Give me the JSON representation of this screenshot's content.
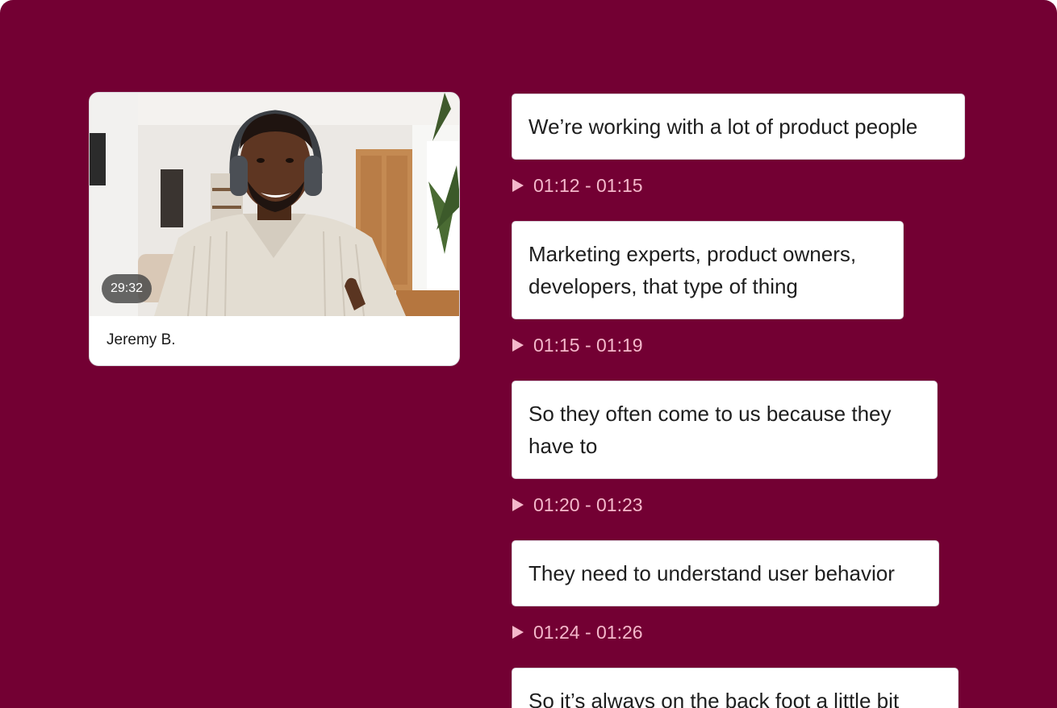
{
  "video": {
    "duration": "29:32",
    "speaker": "Jeremy B."
  },
  "transcript": [
    {
      "text": "We’re working with a lot of product people",
      "time": "01:12 - 01:15"
    },
    {
      "text": "Marketing experts, product owners, developers, that type of thing",
      "time": "01:15 - 01:19"
    },
    {
      "text": "So they often come to us because they have to",
      "time": "01:20 - 01:23"
    },
    {
      "text": "They need to understand user behavior",
      "time": "01:24 - 01:26"
    },
    {
      "text": "So it’s always on the back foot a little bit"
    }
  ],
  "colors": {
    "background": "#730033",
    "timestamp": "#f4b8cb"
  }
}
